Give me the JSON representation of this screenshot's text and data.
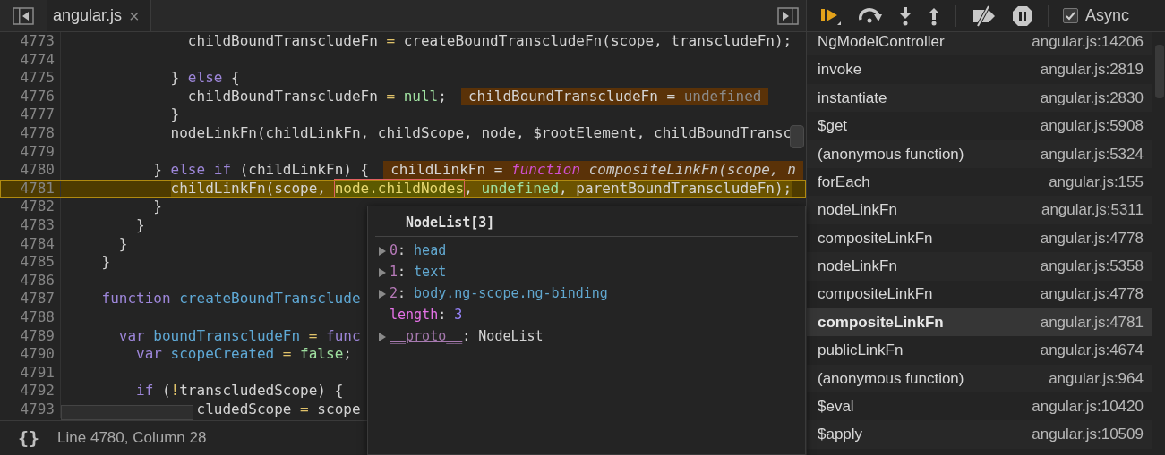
{
  "editor": {
    "tab": {
      "title": "angular.js",
      "close": "×"
    },
    "code_lines": [
      {
        "number": "4773",
        "paused": false,
        "tokens": [
          {
            "text": "              childBoundTranscludeFn ",
            "kind": "plain"
          },
          {
            "text": "=",
            "kind": "operator"
          },
          {
            "text": " createBoundTranscludeFn(scope, transcludeFn);",
            "kind": "plain"
          }
        ]
      },
      {
        "number": "4774",
        "paused": false
      },
      {
        "number": "4775",
        "paused": false,
        "tokens": [
          {
            "text": "            } ",
            "kind": "plain"
          },
          {
            "text": "else",
            "kind": "keyword"
          },
          {
            "text": " {",
            "kind": "plain"
          }
        ]
      },
      {
        "number": "4776",
        "paused": false,
        "tokens": [
          {
            "text": "              childBoundTranscludeFn ",
            "kind": "plain"
          },
          {
            "text": "=",
            "kind": "operator"
          },
          {
            "text": " null",
            "kind": "literal"
          },
          {
            "text": ";",
            "kind": "plain"
          }
        ],
        "annotation": [
          {
            "text": "childBoundTranscludeFn = ",
            "kind": "plain"
          },
          {
            "text": "undefined",
            "kind": "muted"
          }
        ]
      },
      {
        "number": "4777",
        "paused": false,
        "tokens": [
          {
            "text": "            }",
            "kind": "plain"
          }
        ]
      },
      {
        "number": "4778",
        "paused": false,
        "tokens": [
          {
            "text": "            nodeLinkFn(childLinkFn, childScope, node, $rootElement, childBoundTransc",
            "kind": "plain"
          }
        ]
      },
      {
        "number": "4779",
        "paused": false
      },
      {
        "number": "4780",
        "paused": false,
        "tokens": [
          {
            "text": "          } ",
            "kind": "plain"
          },
          {
            "text": "else if",
            "kind": "keyword"
          },
          {
            "text": " (childLinkFn) {",
            "kind": "plain"
          }
        ],
        "annotation": [
          {
            "text": "childLinkFn = ",
            "kind": "plain"
          },
          {
            "text": "function",
            "kind": "function"
          },
          {
            "text": " compositeLinkFn(scope, n",
            "kind": "italic"
          }
        ]
      },
      {
        "number": "4781",
        "paused": true,
        "tokens": [
          {
            "text": "            childLinkFn(scope, ",
            "kind": "plain"
          },
          {
            "text": "node.childNodes",
            "kind": "hover"
          },
          {
            "text": ", ",
            "kind": "plain"
          },
          {
            "text": "undefined",
            "kind": "literal"
          },
          {
            "text": ", parentBoundTranscludeFn);",
            "kind": "plain"
          }
        ]
      },
      {
        "number": "4782",
        "paused": false,
        "tokens": [
          {
            "text": "          }",
            "kind": "plain"
          }
        ]
      },
      {
        "number": "4783",
        "paused": false,
        "tokens": [
          {
            "text": "        }",
            "kind": "plain"
          }
        ]
      },
      {
        "number": "4784",
        "paused": false,
        "tokens": [
          {
            "text": "      }",
            "kind": "plain"
          }
        ]
      },
      {
        "number": "4785",
        "paused": false,
        "tokens": [
          {
            "text": "    }",
            "kind": "plain"
          }
        ]
      },
      {
        "number": "4786",
        "paused": false
      },
      {
        "number": "4787",
        "paused": false,
        "tokens": [
          {
            "text": "    function",
            "kind": "keyword"
          },
          {
            "text": " createBoundTransclude",
            "kind": "def"
          }
        ]
      },
      {
        "number": "4788",
        "paused": false
      },
      {
        "number": "4789",
        "paused": false,
        "tokens": [
          {
            "text": "      var",
            "kind": "keyword"
          },
          {
            "text": " boundTranscludeFn ",
            "kind": "def"
          },
          {
            "text": "=",
            "kind": "operator"
          },
          {
            "text": " func",
            "kind": "keyword"
          }
        ]
      },
      {
        "number": "4790",
        "paused": false,
        "tokens": [
          {
            "text": "        var",
            "kind": "keyword"
          },
          {
            "text": " scopeCreated ",
            "kind": "def"
          },
          {
            "text": "=",
            "kind": "operator"
          },
          {
            "text": " false",
            "kind": "literal"
          },
          {
            "text": ";",
            "kind": "plain"
          }
        ]
      },
      {
        "number": "4791",
        "paused": false
      },
      {
        "number": "4792",
        "paused": false,
        "tokens": [
          {
            "text": "        if",
            "kind": "keyword"
          },
          {
            "text": " (",
            "kind": "plain"
          },
          {
            "text": "!",
            "kind": "operator"
          },
          {
            "text": "transcludedScope) {",
            "kind": "plain"
          }
        ]
      },
      {
        "number": "4793",
        "paused": false,
        "tokens": [
          {
            "text": "               cludedScope ",
            "kind": "plain"
          },
          {
            "text": "=",
            "kind": "operator"
          },
          {
            "text": " scope",
            "kind": "plain"
          }
        ]
      }
    ],
    "popover": {
      "title": "NodeList[3]",
      "entries": [
        {
          "key": "0",
          "separator": ":",
          "value": "head",
          "kind": "index",
          "expandable": true
        },
        {
          "key": "1",
          "separator": ":",
          "value": "text",
          "kind": "index",
          "expandable": true
        },
        {
          "key": "2",
          "separator": ":",
          "value": "body.ng-scope.ng-binding",
          "kind": "index",
          "expandable": true
        },
        {
          "key": "length",
          "separator": ":",
          "value": "3",
          "kind": "length",
          "expandable": false
        },
        {
          "key": "__proto__",
          "separator": ":",
          "value": "NodeList",
          "kind": "proto",
          "expandable": true
        }
      ]
    },
    "status_bar": {
      "format_button": "{}",
      "position": "Line 4780, Column 28"
    }
  },
  "debugger": {
    "toolbar": [
      {
        "kind": "resume"
      },
      {
        "kind": "step-over"
      },
      {
        "kind": "step-into"
      },
      {
        "kind": "step-out"
      },
      {
        "kind": "separator"
      },
      {
        "kind": "deactivate"
      },
      {
        "kind": "pause-exceptions"
      },
      {
        "kind": "separator"
      }
    ],
    "async": {
      "label": "Async",
      "checked": true
    },
    "call_stack": [
      {
        "name": "NgModelController",
        "location": "angular.js:14206",
        "selected": false
      },
      {
        "name": "invoke",
        "location": "angular.js:2819",
        "selected": false
      },
      {
        "name": "instantiate",
        "location": "angular.js:2830",
        "selected": false
      },
      {
        "name": "$get",
        "location": "angular.js:5908",
        "selected": false
      },
      {
        "name": "(anonymous function)",
        "location": "angular.js:5324",
        "selected": false
      },
      {
        "name": "forEach",
        "location": "angular.js:155",
        "selected": false
      },
      {
        "name": "nodeLinkFn",
        "location": "angular.js:5311",
        "selected": false
      },
      {
        "name": "compositeLinkFn",
        "location": "angular.js:4778",
        "selected": false
      },
      {
        "name": "nodeLinkFn",
        "location": "angular.js:5358",
        "selected": false
      },
      {
        "name": "compositeLinkFn",
        "location": "angular.js:4778",
        "selected": false
      },
      {
        "name": "compositeLinkFn",
        "location": "angular.js:4781",
        "selected": true
      },
      {
        "name": "publicLinkFn",
        "location": "angular.js:4674",
        "selected": false
      },
      {
        "name": "(anonymous function)",
        "location": "angular.js:964",
        "selected": false
      },
      {
        "name": "$eval",
        "location": "angular.js:10420",
        "selected": false
      },
      {
        "name": "$apply",
        "location": "angular.js:10509",
        "selected": false
      }
    ]
  }
}
